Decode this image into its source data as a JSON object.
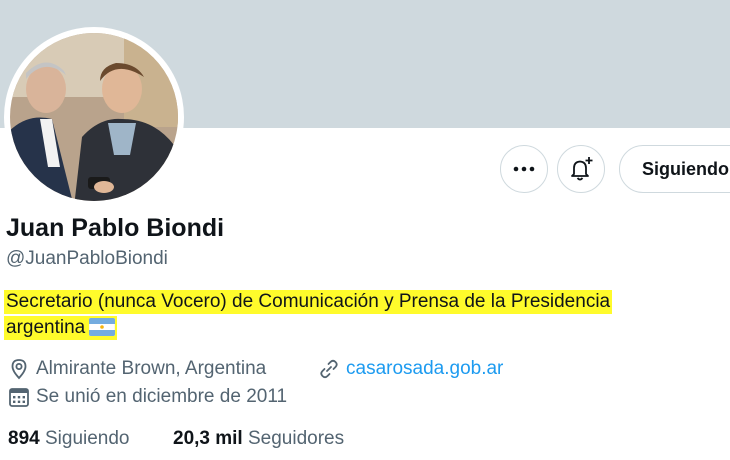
{
  "profile": {
    "name": "Juan Pablo Biondi",
    "handle": "@JuanPabloBiondi",
    "bio_line1": "Secretario (nunca Vocero) de Comunicación y Prensa de la Presidencia",
    "bio_line2": "argentina",
    "location": "Almirante Brown, Argentina",
    "website": "casarosada.gob.ar",
    "joined": "Se unió en diciembre de 2011"
  },
  "actions": {
    "more_icon": "more-horizontal-icon",
    "notify_icon": "bell-plus-icon",
    "follow_label": "Siguiendo"
  },
  "stats": {
    "following_count": "894",
    "following_label": "Siguiendo",
    "followers_count": "20,3 mil",
    "followers_label": "Seguidores"
  },
  "colors": {
    "banner": "#cfd9de",
    "link": "#1d9bf0",
    "secondary_text": "#536471",
    "highlight": "#fffb2b"
  }
}
